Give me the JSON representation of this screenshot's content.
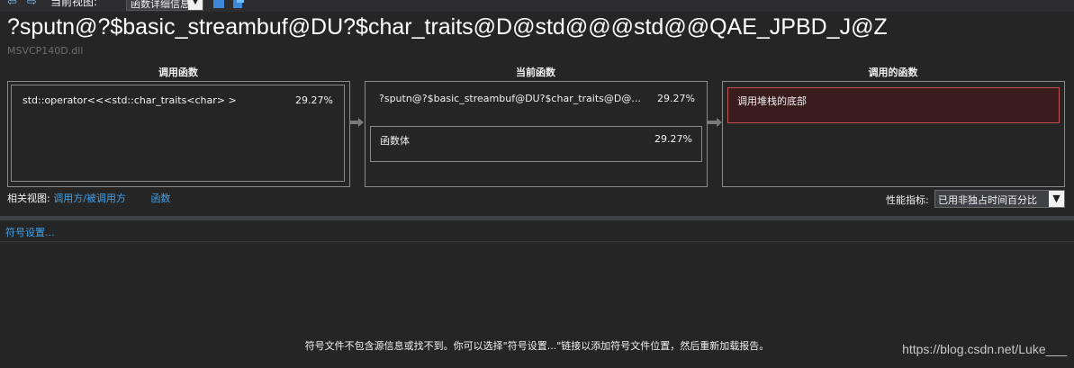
{
  "toolbar": {
    "current_view_label": "当前视图:",
    "view_select_value": "函数详细信息"
  },
  "header": {
    "title": "?sputn@?$basic_streambuf@DU?$char_traits@D@std@@@std@@QAE_JPBD_J@Z",
    "module": "MSVCP140D.dll"
  },
  "columns": {
    "calling": {
      "header": "调用函数",
      "items": [
        {
          "name": "std::operator<<<std::char_traits<char> >",
          "percent": "29.27%"
        }
      ]
    },
    "current": {
      "header": "当前函数",
      "name": "?sputn@?$basic_streambuf@DU?$char_traits@D@...",
      "percent": "29.27%",
      "body_label": "函数体",
      "body_percent": "29.27%"
    },
    "called": {
      "header": "调用的函数",
      "items": [
        {
          "name": "调用堆栈的底部"
        }
      ]
    }
  },
  "related_views": {
    "label": "相关视图:",
    "caller_callee_link": "调用方/被调用方",
    "functions_link": "函数"
  },
  "metric": {
    "label": "性能指标:",
    "value": "已用非独占时间百分比"
  },
  "symbol_settings_link": "符号设置...",
  "message": "符号文件不包含源信息或找不到。你可以选择\"符号设置...\"链接以添加符号文件位置，然后重新加载报告。",
  "watermark": "https://blog.csdn.net/Luke___",
  "colors": {
    "background": "#252526",
    "link": "#3ea4f0",
    "highlight_border": "#c0504d",
    "highlight_fill": "#3a1c1c"
  }
}
